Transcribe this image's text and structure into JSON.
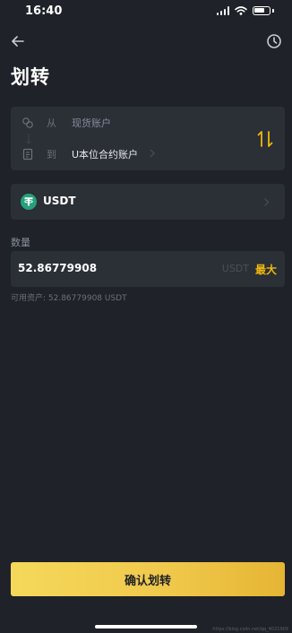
{
  "status_bar": {
    "time": "16:40",
    "icons": [
      "cellular-signal-icon",
      "wifi-icon",
      "battery-icon"
    ]
  },
  "header": {
    "title": "划转",
    "back_icon": "back-arrow-icon",
    "history_icon": "history-clock-icon"
  },
  "transfer": {
    "from_label": "从",
    "from_account": "现货账户",
    "to_label": "到",
    "to_account": "U本位合约账户",
    "swap_icon": "swap-vertical-icon"
  },
  "coin": {
    "name": "USDT",
    "icon": "tether-icon"
  },
  "amount": {
    "label": "数量",
    "value": "52.86779908",
    "unit": "USDT",
    "max_label": "最大",
    "available": "可用资产: 52.86779908 USDT"
  },
  "confirm_button": "确认划转",
  "watermark": "https://blog.csdn.net/qq_4021909",
  "colors": {
    "background": "#1f2228",
    "card": "#2b2f36",
    "accent": "#f0b90b",
    "tether": "#26a17b"
  }
}
